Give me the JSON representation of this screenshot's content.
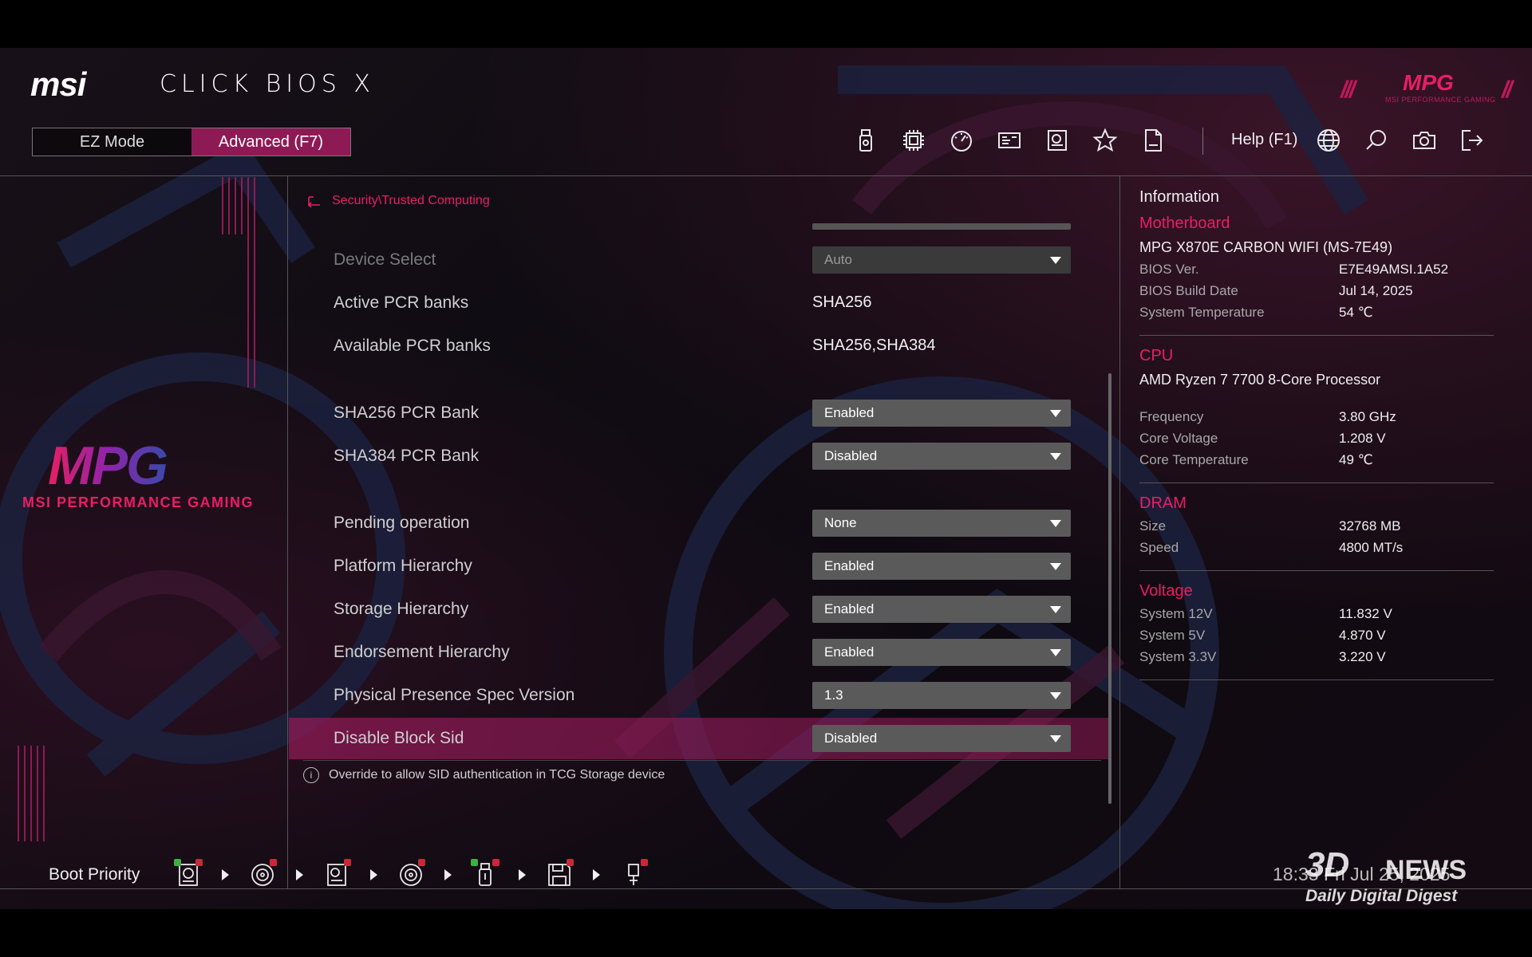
{
  "header": {
    "brand": "msi",
    "product": "CLICK BIOS X",
    "modes": {
      "ez": "EZ Mode",
      "advanced": "Advanced (F7)"
    },
    "help_label": "Help (F1)",
    "toolbar_icons": [
      "usb-drive-icon",
      "cpu-icon",
      "gauge-icon",
      "hardware-monitor-icon",
      "board-explorer-icon",
      "favorites-star-icon",
      "log-file-icon"
    ],
    "utility_icons": [
      "language-globe-icon",
      "search-icon",
      "screenshot-camera-icon",
      "exit-icon"
    ]
  },
  "brand_block": {
    "logo": "MPG",
    "tagline": "MSI PERFORMANCE GAMING",
    "top_logo_sub": "MSI PERFORMANCE GAMING"
  },
  "main": {
    "breadcrumb": "Security\\Trusted Computing",
    "settings": [
      {
        "label": "Device Select",
        "value": "Auto",
        "kind": "dropdown",
        "disabled": true
      },
      {
        "label": "Active PCR banks",
        "value": "SHA256",
        "kind": "text"
      },
      {
        "label": "Available PCR banks",
        "value": "SHA256,SHA384",
        "kind": "text"
      },
      {
        "label": "SHA256 PCR Bank",
        "value": "Enabled",
        "kind": "dropdown"
      },
      {
        "label": "SHA384 PCR Bank",
        "value": "Disabled",
        "kind": "dropdown"
      },
      {
        "label": "Pending operation",
        "value": "None",
        "kind": "dropdown"
      },
      {
        "label": "Platform Hierarchy",
        "value": "Enabled",
        "kind": "dropdown"
      },
      {
        "label": "Storage Hierarchy",
        "value": "Enabled",
        "kind": "dropdown"
      },
      {
        "label": "Endorsement Hierarchy",
        "value": "Enabled",
        "kind": "dropdown"
      },
      {
        "label": "Physical Presence Spec Version",
        "value": "1.3",
        "kind": "dropdown"
      },
      {
        "label": "Disable Block Sid",
        "value": "Disabled",
        "kind": "dropdown",
        "selected": true
      }
    ],
    "help_text": "Override to allow SID authentication in TCG Storage device"
  },
  "info": {
    "title": "Information",
    "motherboard": {
      "heading": "Motherboard",
      "model": "MPG X870E CARBON WIFI (MS-7E49)",
      "rows": [
        {
          "k": "BIOS Ver.",
          "v": "E7E49AMSI.1A52"
        },
        {
          "k": "BIOS Build Date",
          "v": "Jul 14, 2025"
        },
        {
          "k": "System Temperature",
          "v": "54 ℃"
        }
      ]
    },
    "cpu": {
      "heading": "CPU",
      "model": "AMD Ryzen 7 7700 8-Core Processor",
      "rows": [
        {
          "k": "Frequency",
          "v": "3.80 GHz"
        },
        {
          "k": "Core Voltage",
          "v": "1.208 V"
        },
        {
          "k": "Core Temperature",
          "v": "49 ℃"
        }
      ]
    },
    "dram": {
      "heading": "DRAM",
      "rows": [
        {
          "k": "Size",
          "v": "32768 MB"
        },
        {
          "k": "Speed",
          "v": "4800 MT/s"
        }
      ]
    },
    "voltage": {
      "heading": "Voltage",
      "rows": [
        {
          "k": "System 12V",
          "v": "11.832 V"
        },
        {
          "k": "System 5V",
          "v": "4.870 V"
        },
        {
          "k": "System 3.3V",
          "v": "3.220 V"
        }
      ]
    }
  },
  "footer": {
    "boot_priority_label": "Boot Priority",
    "boot_devices": [
      "hdd-icon",
      "optical-disc-icon",
      "network-boot-icon",
      "optical-disc-2-icon",
      "usb-key-icon",
      "floppy-usb-icon",
      "usb-device-icon"
    ],
    "clock": "18:33  Fri Jul 25, 2025",
    "watermark": {
      "brand": "3D",
      "news": "NEWS",
      "tagline": "Daily Digital Digest"
    }
  },
  "colors": {
    "accent": "#e91e63",
    "accent_dark": "#8e1a55",
    "dropdown": "#5a5a5a"
  }
}
